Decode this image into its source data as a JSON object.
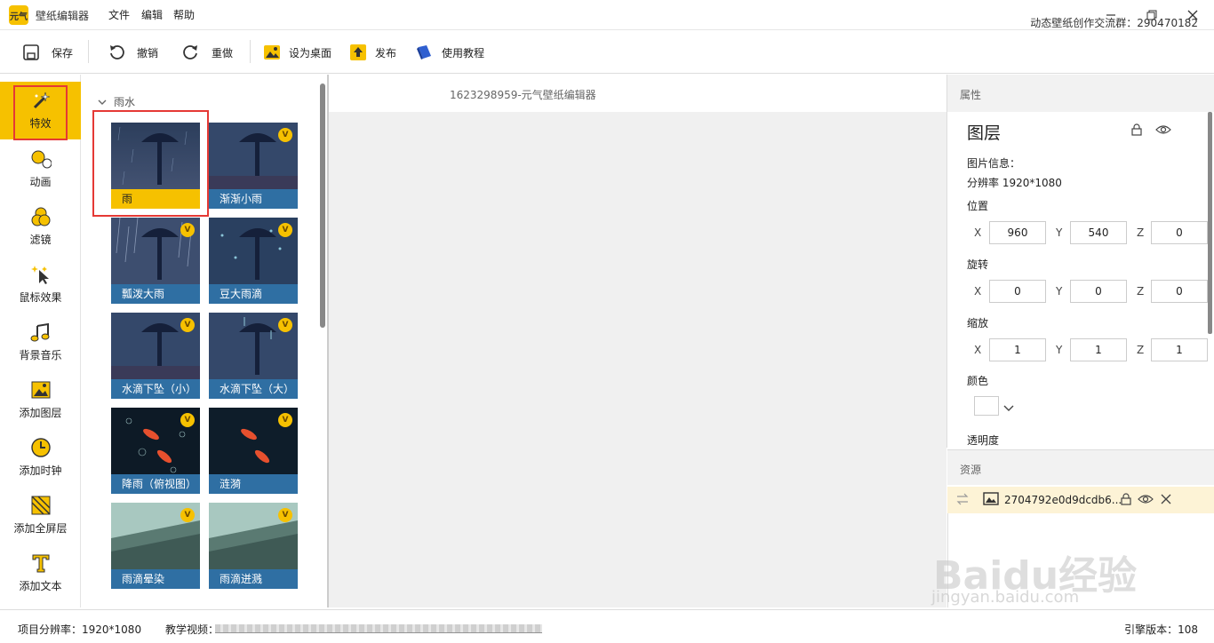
{
  "titlebar": {
    "logo_text": "元气",
    "app_title": "壁纸编辑器",
    "menus": [
      "文件",
      "编辑",
      "帮助"
    ],
    "window_controls": [
      "minimize-icon",
      "restore-icon",
      "close-icon"
    ]
  },
  "toolbar": {
    "save": "保存",
    "undo": "撤销",
    "redo": "重做",
    "set_desktop": "设为桌面",
    "publish": "发布",
    "tutorial": "使用教程",
    "community": "动态壁纸创作交流群：290470182"
  },
  "leftnav": [
    {
      "label": "特效",
      "icon": "magic-wand-icon"
    },
    {
      "label": "动画",
      "icon": "animation-icon"
    },
    {
      "label": "滤镜",
      "icon": "filter-icon"
    },
    {
      "label": "鼠标效果",
      "icon": "cursor-sparkle-icon"
    },
    {
      "label": "背景音乐",
      "icon": "music-note-icon"
    },
    {
      "label": "添加图层",
      "icon": "image-icon"
    },
    {
      "label": "添加时钟",
      "icon": "clock-icon"
    },
    {
      "label": "添加全屏层",
      "icon": "fullscreen-layer-icon"
    },
    {
      "label": "添加文本",
      "icon": "text-icon"
    }
  ],
  "effects": {
    "category": "雨水",
    "items": [
      {
        "label": "雨",
        "vip": false
      },
      {
        "label": "渐渐小雨",
        "vip": true
      },
      {
        "label": "瓢泼大雨",
        "vip": true
      },
      {
        "label": "豆大雨滴",
        "vip": true
      },
      {
        "label": "水滴下坠（小）",
        "vip": true
      },
      {
        "label": "水滴下坠（大）",
        "vip": true
      },
      {
        "label": "降雨（俯视图）",
        "vip": true
      },
      {
        "label": "涟漪",
        "vip": true
      },
      {
        "label": "雨滴晕染",
        "vip": true
      },
      {
        "label": "雨滴迸溅",
        "vip": true
      }
    ]
  },
  "canvas": {
    "name": "1623298959-元气壁纸编辑器"
  },
  "properties": {
    "header": "属性",
    "layer_title": "图层",
    "image_info_label": "图片信息：",
    "resolution": "分辨率 1920*1080",
    "position_label": "位置",
    "position": {
      "x": "960",
      "y": "540",
      "z": "0"
    },
    "rotation_label": "旋转",
    "rotation": {
      "x": "0",
      "y": "0",
      "z": "0"
    },
    "scale_label": "缩放",
    "scale": {
      "x": "1",
      "y": "1",
      "z": "1"
    },
    "color_label": "颜色",
    "opacity_label": "透明度",
    "axes": {
      "x": "X",
      "y": "Y",
      "z": "Z"
    }
  },
  "resources": {
    "header": "资源",
    "item_name": "2704792e0d9dcdb6..."
  },
  "statusbar": {
    "project_resolution": "项目分辨率：1920*1080",
    "video_label": "教学视频：",
    "engine_version": "引擎版本：108"
  },
  "watermark": {
    "main": "Baidu经验",
    "sub": "jingyan.baidu.com"
  },
  "colors": {
    "accent": "#f6c100",
    "caption_blue": "#2f6fa3",
    "highlight_red": "#e53935"
  }
}
